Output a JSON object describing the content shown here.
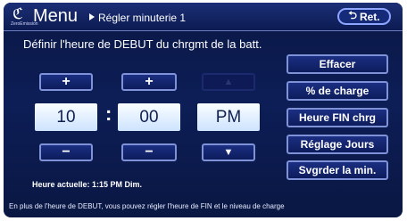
{
  "header": {
    "logo_text": "ZeroEmission",
    "title": "Menu",
    "breadcrumb": "Régler minuterie 1",
    "return_label": "Ret."
  },
  "instruction": "Définir l'heure de DEBUT du chrgmt de la batt.",
  "time": {
    "hour": "10",
    "minute": "00",
    "ampm": "PM",
    "separator": ":"
  },
  "steppers": {
    "plus": "+",
    "minus": "−",
    "up": "▲",
    "down": "▼"
  },
  "side_buttons": {
    "clear": "Effacer",
    "charge_pct": "% de charge",
    "end_time": "Heure FIN chrg",
    "days": "Réglage Jours",
    "save": "Svgrder la min."
  },
  "current_time": "Heure actuelle:  1:15 PM Dim.",
  "hint": "En plus de l'heure de DEBUT, vous pouvez régler l'heure de FIN et le niveau de charge"
}
